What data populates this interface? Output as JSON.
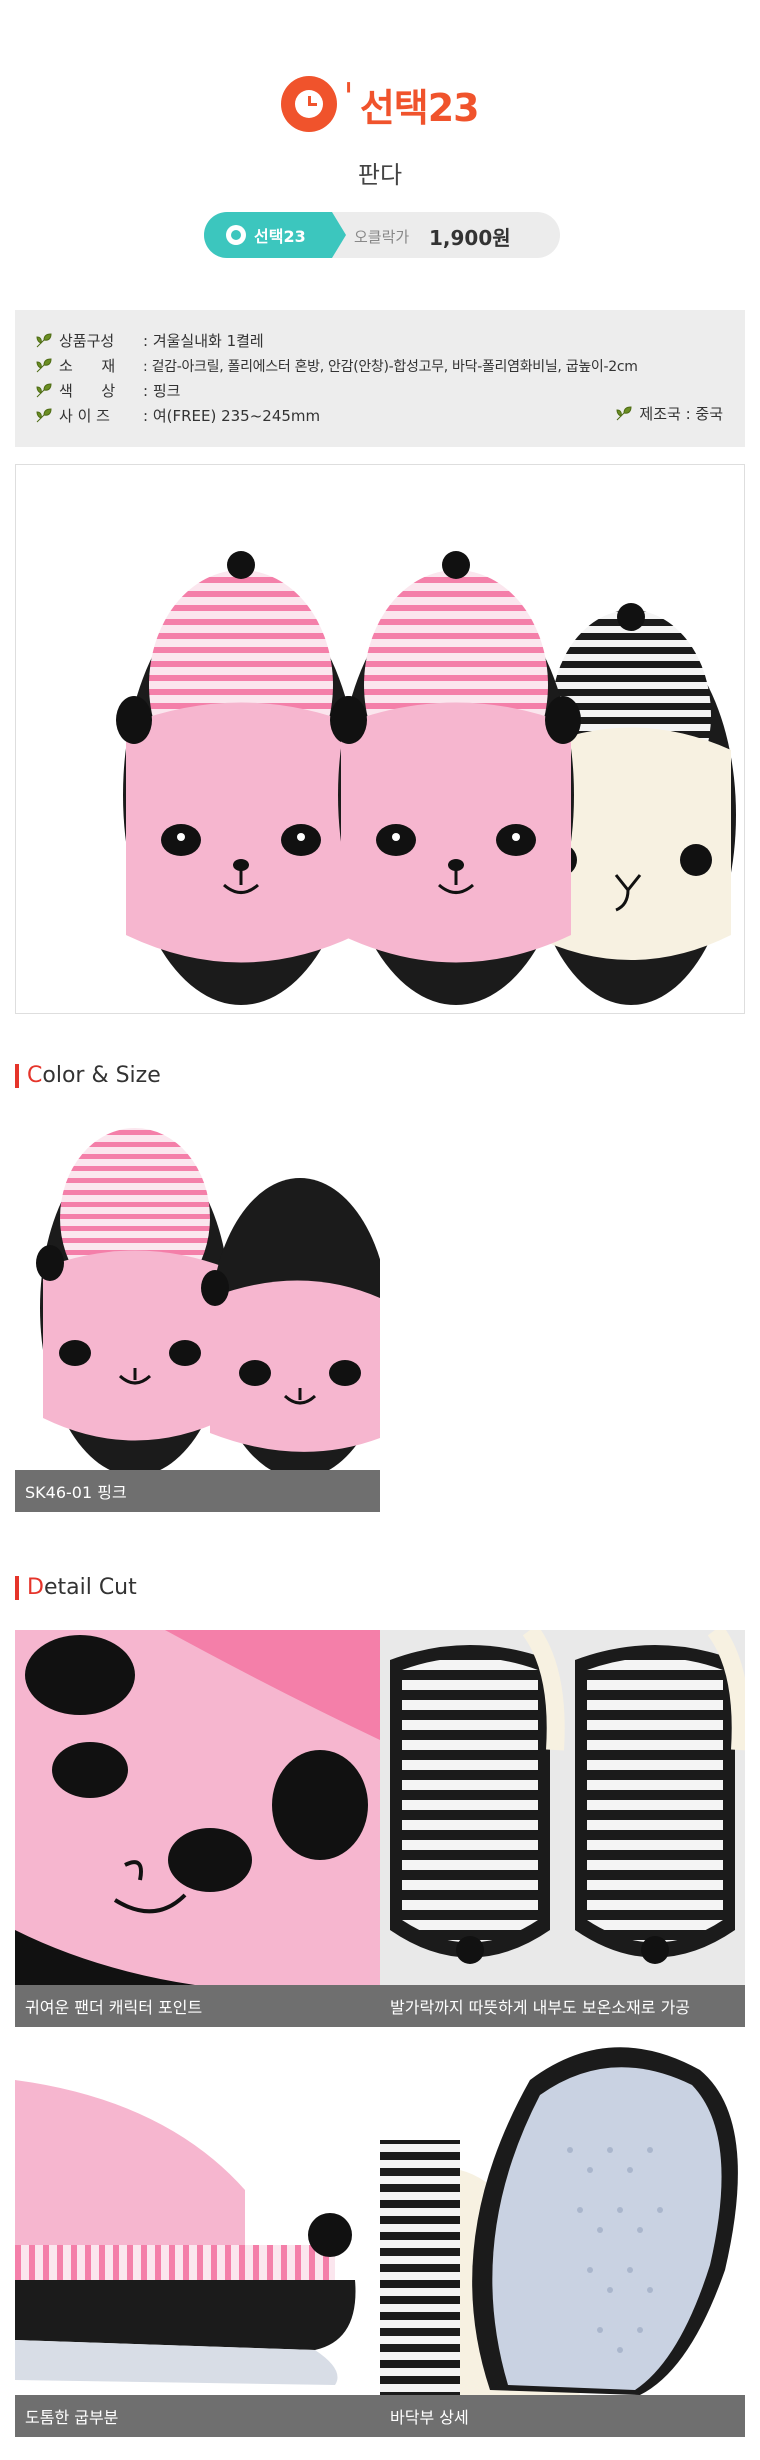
{
  "header": {
    "brand_name": "선택23",
    "product_name": "판다",
    "badge_label": "선택23",
    "price_label": "오클락가",
    "price_value": "1,900원"
  },
  "info": {
    "rows": [
      {
        "key": "상품구성",
        "value": ": 겨울실내화 1켤레"
      },
      {
        "key": "소      재",
        "value": ": 겉감-아크릴, 폴리에스터 혼방, 안감(안창)-합성고무, 바닥-폴리염화비닐, 굽높이-2cm"
      },
      {
        "key": "색      상",
        "value": ": 핑크"
      },
      {
        "key": "사 이 즈",
        "value": ": 여(FREE) 235~245mm"
      }
    ],
    "origin": "제조국 : 중국"
  },
  "sections": {
    "color_size": {
      "first": "C",
      "rest": "olor & Size"
    },
    "detail_cut": {
      "first": "D",
      "rest": "etail Cut"
    }
  },
  "color_size_caption": "SK46-01 핑크",
  "detail_captions": [
    "귀여운 팬더 캐릭터 포인트",
    "발가락까지 따뜻하게 내부도 보온소재로 가공",
    "도톰한 굽부분",
    "바닥부 상세"
  ],
  "colors": {
    "accent": "#f0532c",
    "badge": "#3cc6be",
    "slipper_pink": "#f6b6cf",
    "slipper_cream": "#f7f1e1",
    "caption_bg": "#6f6f6f",
    "section_bar": "#e5342a"
  }
}
